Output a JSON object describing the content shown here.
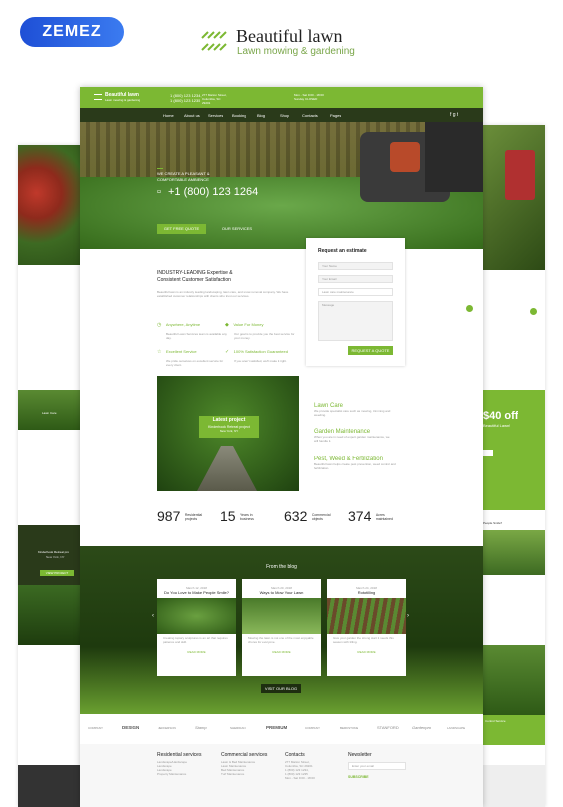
{
  "brand": {
    "logo": "ZEMEZ"
  },
  "template": {
    "title": "Beautiful lawn",
    "subtitle": "Lawn mowing & gardening",
    "logo_icon": "grass-stripes-icon"
  },
  "topbar": {
    "site_name": "Beautiful lawn",
    "site_tag": "Lawn mowing & gardening",
    "phone1": "1 (800) 123 1234,",
    "phone2": "1 (800) 123 1235",
    "address": "277 Marion Street, Columbia, SC 29201",
    "hours": "Mon - Sat 9:00 - 18:00 Sunday CLOSED"
  },
  "nav": {
    "items": [
      "Home",
      "About us",
      "Services",
      "Booking",
      "Blog",
      "Shop",
      "Contacts",
      "Pages"
    ]
  },
  "hero": {
    "tagline": "WE CREATE A PLEASANT & COMFORTABLE AMBIENCE",
    "phone": "+1 (800) 123 1264",
    "btn_quote": "GET FREE QUOTE",
    "btn_services": "OUR SERVICES",
    "pager": "01 / 03"
  },
  "intro": {
    "heading": "INDUSTRY-LEADING Expertise & Consistent Customer Satisfaction",
    "text": "Beautiful lawn is an industry leading landscaping, lawn care, and snow removal company. We have established customer relationships with clients who trust our services.",
    "features": [
      {
        "title": "Anywhere, Anytime",
        "icon": "clock-icon",
        "text": "Beautiful Lawn Services team is available any day."
      },
      {
        "title": "Value For Money",
        "icon": "tag-icon",
        "text": "Our goal is to provide you the best service for your money."
      },
      {
        "title": "Excellent Service",
        "icon": "star-icon",
        "text": "We pride ourselves on excellent service for every client."
      },
      {
        "title": "100% Satisfaction Guaranteed",
        "icon": "check-icon",
        "text": "If you aren't satisfied, we'll make it right."
      }
    ]
  },
  "estimate": {
    "title": "Request an estimate",
    "name_ph": "Your Name",
    "email_ph": "Your Email",
    "select": "Lawn care maintenance",
    "message_ph": "Message",
    "button": "REQUEST A QUOTE"
  },
  "project": {
    "title": "Latest project",
    "name": "Kinderhook Retreat project",
    "location": "New York, NY"
  },
  "services": [
    {
      "title": "Lawn Care",
      "text": "We provide specialist care such as mowing, trimming and weeding."
    },
    {
      "title": "Garden Maintenance",
      "text": "When you are in need of expert garden maintenance, we will handle it."
    },
    {
      "title": "Pest, Weed & Fertilization",
      "text": "Beautiful lawn helps create pest prevention, weed control and fertilization."
    }
  ],
  "stats": [
    {
      "value": "987",
      "label": "Residential projects"
    },
    {
      "value": "15",
      "label": "Years in business"
    },
    {
      "value": "632",
      "label": "Commercial objects"
    },
    {
      "value": "374",
      "label": "Acres maintained"
    }
  ],
  "blog": {
    "title": "From the blog",
    "button": "VISIT OUR BLOG",
    "posts": [
      {
        "date": "March 12, 2018",
        "title": "Do You Love to Make People Smile?",
        "text": "Creating topiary sculptures is an art that requires patience and skill.",
        "more": "READ MORE"
      },
      {
        "date": "March 20, 2018",
        "title": "Ways to Mow Your Lawn",
        "text": "Mowing the lawn is not one of the most enjoyable chores for everyone.",
        "more": "READ MORE"
      },
      {
        "date": "March 24, 2018",
        "title": "Rototilling",
        "text": "Give your garden the strong start it needs this season with tilling.",
        "more": "READ MORE"
      }
    ]
  },
  "clients": [
    "COMPANY",
    "DESIGN",
    "JEFFERSON",
    "Stamp",
    "SHERIDAN",
    "PREMIUM",
    "COMPANY",
    "BERKSTONE",
    "STANFORD",
    "Gardenpro",
    "LANDSCAPE"
  ],
  "footer": {
    "col1_title": "Residential services",
    "col1": [
      "Landscape/Hardscape",
      "Landscape",
      "Landscape",
      "Property Maintenance"
    ],
    "col2_title": "Commercial services",
    "col2": [
      "Lawn & Bed Maintenance",
      "Lawn Maintenance",
      "Bed Maintenance",
      "Turf Maintenance"
    ],
    "col3_title": "Contacts",
    "col3": [
      "277 Marion Street,",
      "Columbia, SC 29201",
      "1 (800) 123 1234,",
      "1 (800) 123 1235",
      "Mon - Sat 9:00 - 18:00"
    ],
    "col4_title": "Newsletter",
    "email_ph": "Enter your email",
    "subscribe": "SUBSCRIBE"
  },
  "side_left": {
    "card1": "Lawn Care",
    "project": "Kinderhook Retreat pro",
    "project_loc": "New York, NY",
    "button": "VIEW PROJECT"
  },
  "side_right": {
    "promo_price": "$40 off",
    "promo_text": "Beautiful Lawn!",
    "blog_title": "People Smile?",
    "card": "Control Service"
  },
  "colors": {
    "accent": "#7cb833",
    "dark": "#2a3a1a",
    "zemez": "#1e4fd6"
  }
}
